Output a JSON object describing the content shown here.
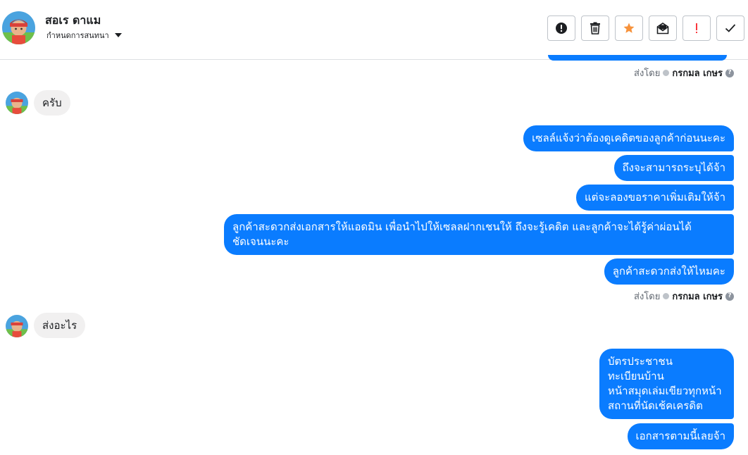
{
  "header": {
    "contact_name": "สอเร ดาแม",
    "assign_label": "กำหนดการสนทนา",
    "actions": [
      {
        "name": "mark-spam-button",
        "icon": "exclamation-circle-icon"
      },
      {
        "name": "delete-button",
        "icon": "trash-icon"
      },
      {
        "name": "star-button",
        "icon": "star-icon"
      },
      {
        "name": "mark-unread-button",
        "icon": "envelope-icon"
      },
      {
        "name": "follow-up-button",
        "icon": "exclamation-icon"
      },
      {
        "name": "mark-done-button",
        "icon": "check-icon"
      }
    ]
  },
  "colors": {
    "outgoing_bubble": "#0a7cff",
    "incoming_bubble": "#f1f0f0",
    "star": "#f7923b",
    "red_mark": "#fa383e"
  },
  "sent_by": {
    "prefix": "ส่งโดย",
    "agent": "กรกมล เกษร",
    "help": "?"
  },
  "messages": {
    "in_1": "ครับ",
    "out_group_1": [
      "เซลล์แจ้งว่าต้องดูเคดิตของลูกค้าก่อนนะคะ",
      "ถึงจะสามารถระบุได้จ้า",
      "แต่จะลองขอราคาเพิ่มเติมให้จ้า",
      [
        "ลูกค้าสะดวกส่งเอกสารให้แอดมิน เพื่อนำไปให้เซลลฝากเชนให้ ถึงจะรู้เคดิต และลูกค้าจะได้รู้ค่าผ่อนได้",
        "ชัดเจนนะคะ"
      ],
      "ลูกค้าสะดวกส่งให้ไหมคะ"
    ],
    "in_2": "ส่งอะไร",
    "out_group_2": [
      [
        "บัตรประชาชน",
        "ทะเบียนบ้าน",
        "หน้าสมุดเล่มเขียวทุกหน้า",
        "สถานที่นัดเช้คเครดิต"
      ],
      "เอกสารตามนี้เลยจ้า"
    ]
  }
}
